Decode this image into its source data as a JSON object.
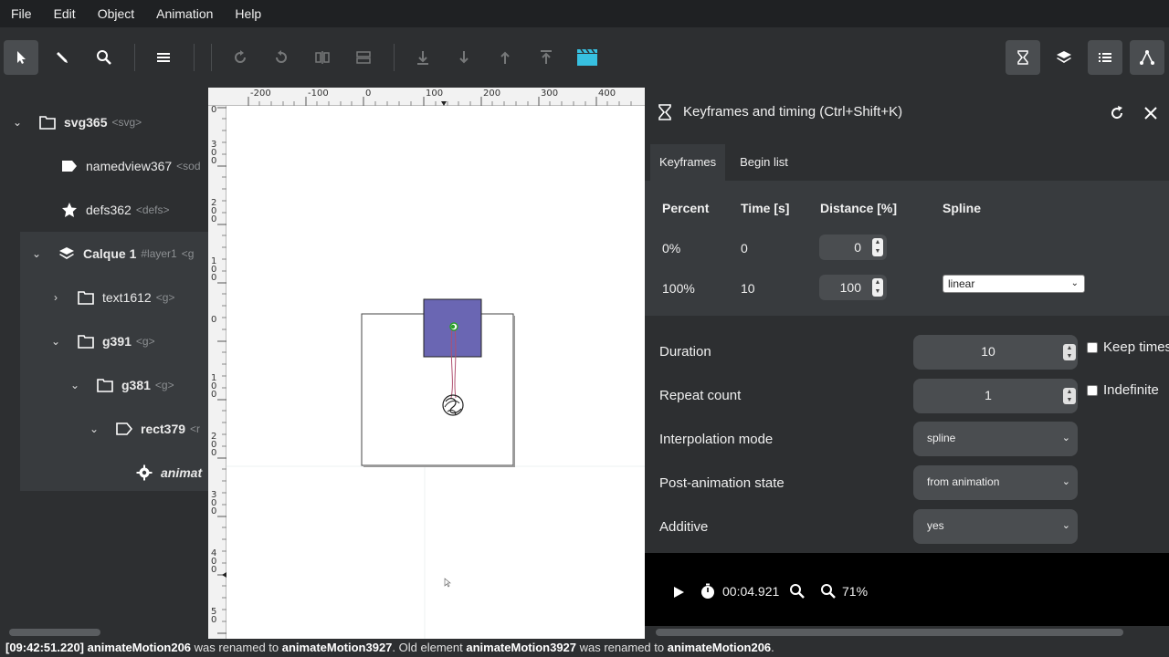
{
  "menu": [
    "File",
    "Edit",
    "Object",
    "Animation",
    "Help"
  ],
  "toolbar": {
    "icons": [
      "select-arrow-icon",
      "pen-icon",
      "zoom-icon",
      "menu-icon",
      "rotate-cw-icon",
      "rotate-ccw-icon",
      "flip-horizontal-icon",
      "flip-vertical-icon",
      "lower-bottom-icon",
      "lower-icon",
      "raise-icon",
      "raise-top-icon",
      "clapperboard-icon",
      "hourglass-icon",
      "layers-icon",
      "list-icon",
      "nodes-icon"
    ]
  },
  "tree": {
    "items": [
      {
        "name": "svg365",
        "tag": "<svg>",
        "icon": "folder-icon"
      },
      {
        "name": "namedview367",
        "tag": "<sod",
        "icon": "tag-icon"
      },
      {
        "name": "defs362",
        "tag": "<defs>",
        "icon": "star-icon"
      },
      {
        "name": "Calque 1",
        "tag": "#layer1",
        "tag2": "<g",
        "icon": "layers-icon"
      },
      {
        "name": "text1612",
        "tag": "<g>",
        "icon": "folder-icon"
      },
      {
        "name": "g391",
        "tag": "<g>",
        "icon": "folder-icon"
      },
      {
        "name": "g381",
        "tag": "<g>",
        "icon": "folder-icon"
      },
      {
        "name": "rect379",
        "tag": "<r",
        "icon": "tag-icon"
      },
      {
        "name": "animat",
        "tag": "",
        "icon": "gear-icon"
      }
    ]
  },
  "ruler": {
    "top": [
      "-200",
      "-100",
      "0",
      "100",
      "200",
      "300",
      "400"
    ],
    "left": [
      "0",
      "3 0 0",
      "2 0 0",
      "1 0 0",
      "0",
      "1 0 0",
      "2 0 0",
      "3 0 0",
      "4 0 0",
      "5 0"
    ]
  },
  "dock": {
    "title": "Keyframes and timing (Ctrl+Shift+K)",
    "tabs": [
      "Keyframes",
      "Begin list"
    ],
    "table": {
      "headers": [
        "Percent",
        "Time [s]",
        "Distance [%]",
        "Spline"
      ],
      "rows": [
        {
          "percent": "0%",
          "time": "0",
          "distance": "0",
          "spline": ""
        },
        {
          "percent": "100%",
          "time": "10",
          "distance": "100",
          "spline": "linear"
        }
      ]
    },
    "props": {
      "duration_label": "Duration",
      "duration_value": "10",
      "keep_times_label": "Keep times",
      "repeat_label": "Repeat count",
      "repeat_value": "1",
      "indefinite_label": "Indefinite",
      "interp_label": "Interpolation mode",
      "interp_value": "spline",
      "post_label": "Post-animation state",
      "post_value": "from animation",
      "additive_label": "Additive",
      "additive_value": "yes"
    },
    "player": {
      "time": "00:04.921",
      "zoom": "71%"
    }
  },
  "status": {
    "time": "[09:42:51.220]",
    "el1": "animateMotion206",
    "t1": " was renamed to ",
    "el2": "animateMotion3927",
    "t2": ". Old element ",
    "el3": "animateMotion3927",
    "t3": " was renamed to ",
    "el4": "animateMotion206",
    "t4": "."
  },
  "colors": {
    "purple_rect": "#6a66b3",
    "accent_cyan": "#37c0e0"
  }
}
